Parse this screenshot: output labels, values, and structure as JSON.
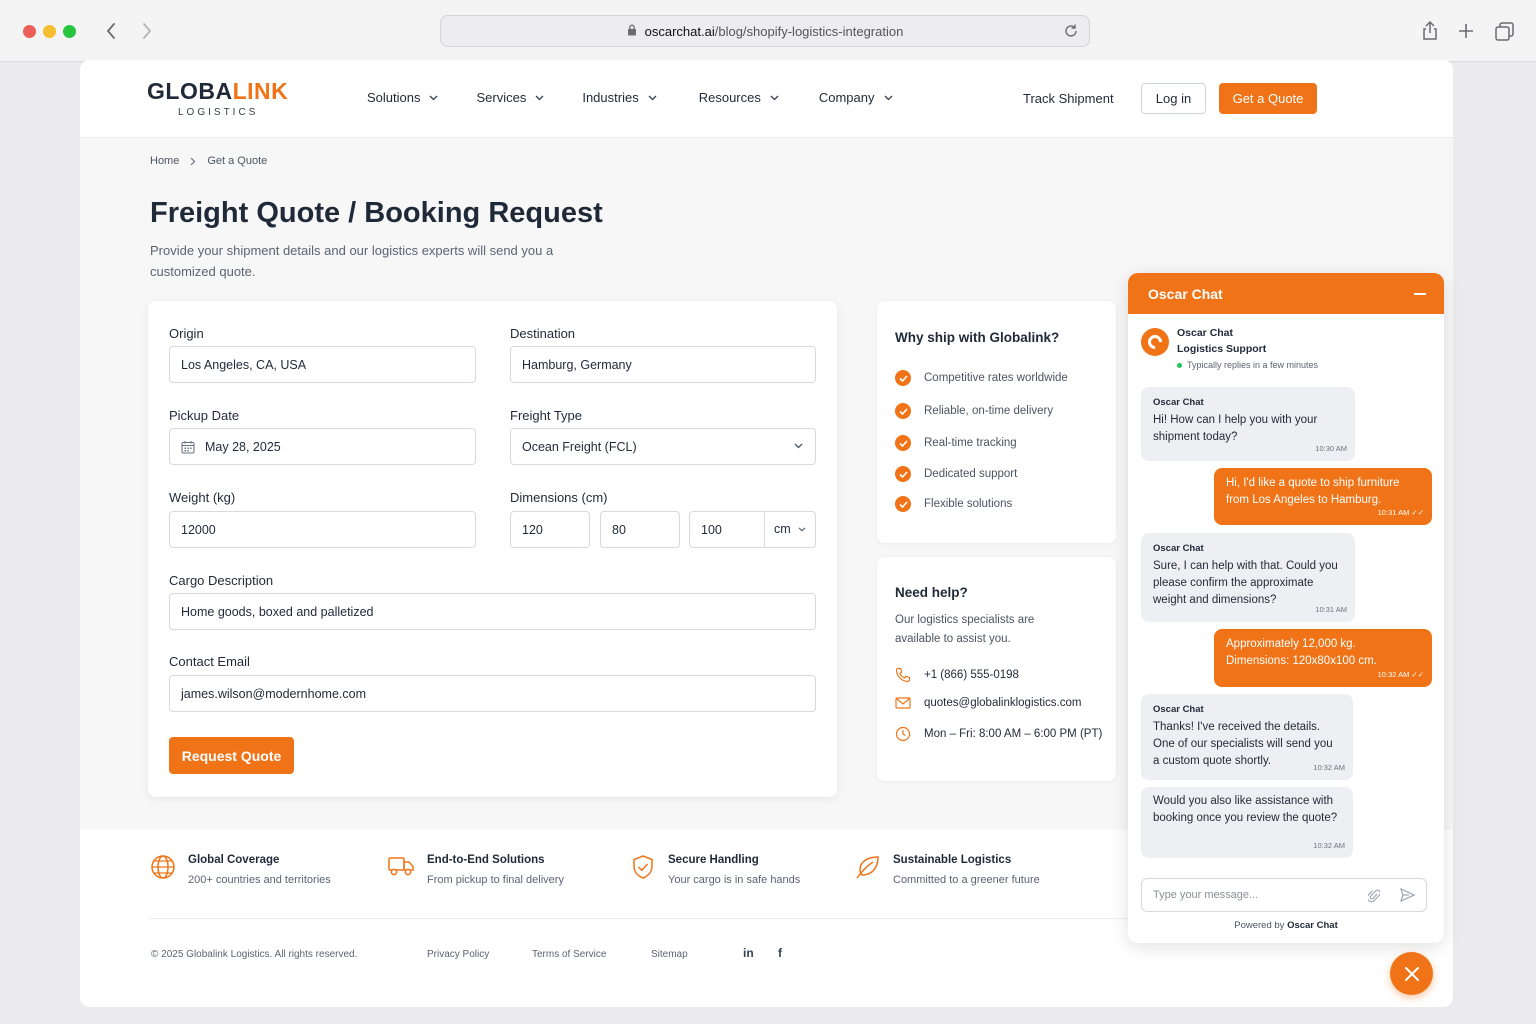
{
  "browser": {
    "url_host": "oscarchat.ai",
    "url_path": "/blog/shopify-logistics-integration"
  },
  "brand": {
    "logo_part1": "GLOBA",
    "logo_part2": "LINK",
    "logo_sub": "LOGISTICS",
    "accent_color": "#f07417"
  },
  "nav": {
    "items": [
      "Solutions",
      "Services",
      "Industries",
      "Resources",
      "Company"
    ],
    "track": "Track Shipment",
    "login": "Log in",
    "quote": "Get a Quote"
  },
  "breadcrumb": [
    "Home",
    "Get a Quote"
  ],
  "page": {
    "title": "Freight Quote / Booking Request",
    "subtitle": "Provide your shipment details and our logistics experts will send you a customized quote."
  },
  "form": {
    "origin_label": "Origin",
    "origin_value": "Los Angeles, CA, USA",
    "destination_label": "Destination",
    "destination_value": "Hamburg, Germany",
    "pickup_label": "Pickup Date",
    "pickup_value": "May 28, 2025",
    "freight_label": "Freight Type",
    "freight_value": "Ocean Freight (FCL)",
    "weight_label": "Weight (kg)",
    "weight_value": "12000",
    "dimensions_label": "Dimensions (cm)",
    "dim_l": "120",
    "dim_w": "80",
    "dim_h": "100",
    "dim_unit": "cm",
    "cargo_label": "Cargo Description",
    "cargo_value": "Home goods, boxed and palletized",
    "email_label": "Contact Email",
    "email_value": "james.wilson@modernhome.com",
    "submit": "Request Quote"
  },
  "why": {
    "title": "Why ship with Globalink?",
    "items": [
      "Competitive rates worldwide",
      "Reliable, on-time delivery",
      "Real-time tracking",
      "Dedicated support",
      "Flexible solutions"
    ]
  },
  "help": {
    "title": "Need help?",
    "text": "Our logistics specialists are available to assist you.",
    "phone": "+1 (866) 555-0198",
    "email": "quotes@globalinklogistics.com",
    "hours": "Mon – Fri: 8:00 AM – 6:00 PM (PT)"
  },
  "features": [
    {
      "title": "Global Coverage",
      "sub": "200+ countries and territories",
      "icon": "globe-icon"
    },
    {
      "title": "End-to-End Solutions",
      "sub": "From pickup to final delivery",
      "icon": "truck-icon"
    },
    {
      "title": "Secure Handling",
      "sub": "Your cargo is in safe hands",
      "icon": "shield-icon"
    },
    {
      "title": "Sustainable Logistics",
      "sub": "Committed to a greener future",
      "icon": "leaf-icon"
    }
  ],
  "footer": {
    "copyright": "© 2025 Globalink Logistics. All rights reserved.",
    "privacy": "Privacy Policy",
    "terms": "Terms of Service",
    "sitemap": "Sitemap",
    "linkedin": "in",
    "facebook": "f"
  },
  "chat": {
    "title": "Oscar Chat",
    "agent_name": "Oscar Chat",
    "agent_role": "Logistics Support",
    "status": "Typically replies in a few minutes",
    "messages": [
      {
        "from": "agent",
        "name": "Oscar Chat",
        "text": "Hi! How can I help you with your shipment today?",
        "time": "10:30 AM"
      },
      {
        "from": "user",
        "text": "Hi, I'd like a quote to ship furniture from Los Angeles to Hamburg.",
        "time": "10:31 AM"
      },
      {
        "from": "agent",
        "name": "Oscar Chat",
        "text": "Sure, I can help with that. Could you please confirm the approximate weight and dimensions?",
        "time": "10:31 AM"
      },
      {
        "from": "user",
        "text": "Approximately 12,000 kg. Dimensions: 120x80x100 cm.",
        "time": "10:32 AM"
      },
      {
        "from": "agent",
        "name": "Oscar Chat",
        "text": "Thanks! I've received the details. One of our specialists will send you a custom quote shortly.",
        "time": "10:32 AM"
      },
      {
        "from": "agent",
        "text": "Would you also like assistance with booking once you review the quote?",
        "time": "10:32 AM"
      }
    ],
    "input_placeholder": "Type your message...",
    "powered_prefix": "Powered by",
    "powered_brand": "Oscar Chat"
  }
}
